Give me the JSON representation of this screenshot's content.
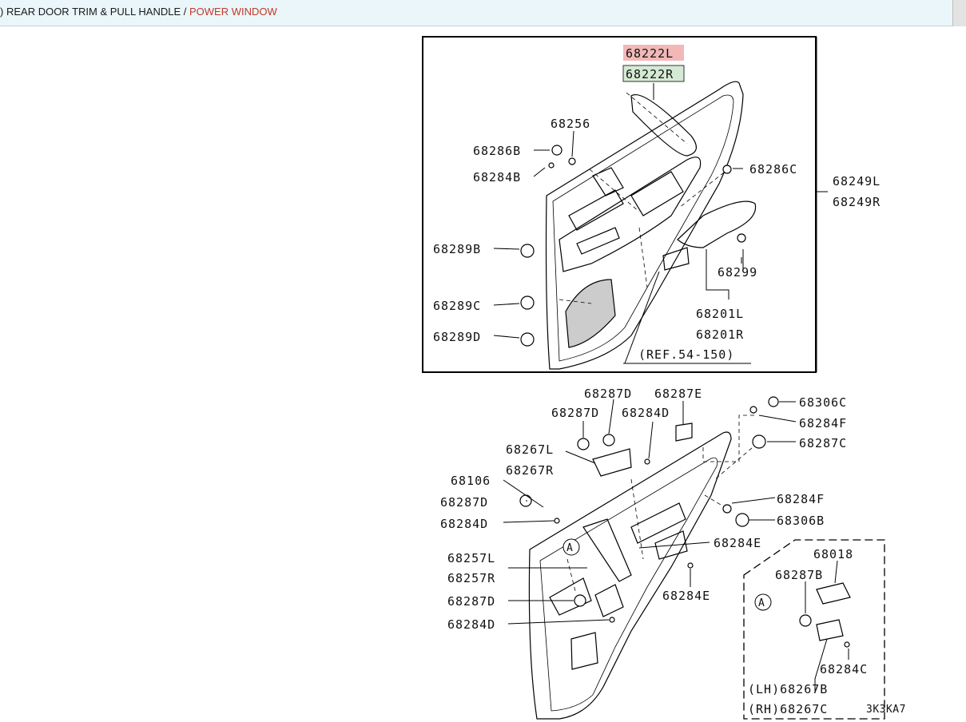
{
  "breadcrumb": {
    "lead": ")",
    "section": "REAR DOOR TRIM & PULL HANDLE",
    "separator": "/",
    "current": "POWER WINDOW"
  },
  "diagram_top": {
    "highlight_left": "68222L",
    "highlight_right": "68222R",
    "labels": {
      "p68256": "68256",
      "p68286B": "68286B",
      "p68284B": "68284B",
      "p68286C": "68286C",
      "p68249L": "68249L",
      "p68249R": "68249R",
      "p68289B": "68289B",
      "p68289C": "68289C",
      "p68289D": "68289D",
      "p68299": "68299",
      "p68201L": "68201L",
      "p68201R": "68201R",
      "ref": "(REF.54-150)"
    }
  },
  "diagram_bottom": {
    "labels": {
      "p68287D_a": "68287D",
      "p68287E": "68287E",
      "p68306C": "68306C",
      "p68287D_b": "68287D",
      "p68284D_a": "68284D",
      "p68284F_a": "68284F",
      "p68287C": "68287C",
      "p68267L": "68267L",
      "p68267R": "68267R",
      "p68106": "68106",
      "p68287D_c": "68287D",
      "p68284D_b": "68284D",
      "p68284F_b": "68284F",
      "p68306B": "68306B",
      "p68284E_a": "68284E",
      "p68257L": "68257L",
      "p68257R": "68257R",
      "p68284E_b": "68284E",
      "p68287D_d": "68287D",
      "p68284D_c": "68284D",
      "callout_a": "A"
    },
    "detail": {
      "p68018": "68018",
      "p68287B": "68287B",
      "callout_a": "A",
      "p68284C": "68284C",
      "lh": "(LH)68267B",
      "rh": "(RH)68267C",
      "code": "3K3KA7"
    }
  },
  "colors": {
    "highlight_left_bg": "#f2b8b8",
    "highlight_right_bg": "#d4ead4",
    "breadcrumb_current": "#c0392b",
    "topbar_bg": "#eaf6fa"
  }
}
